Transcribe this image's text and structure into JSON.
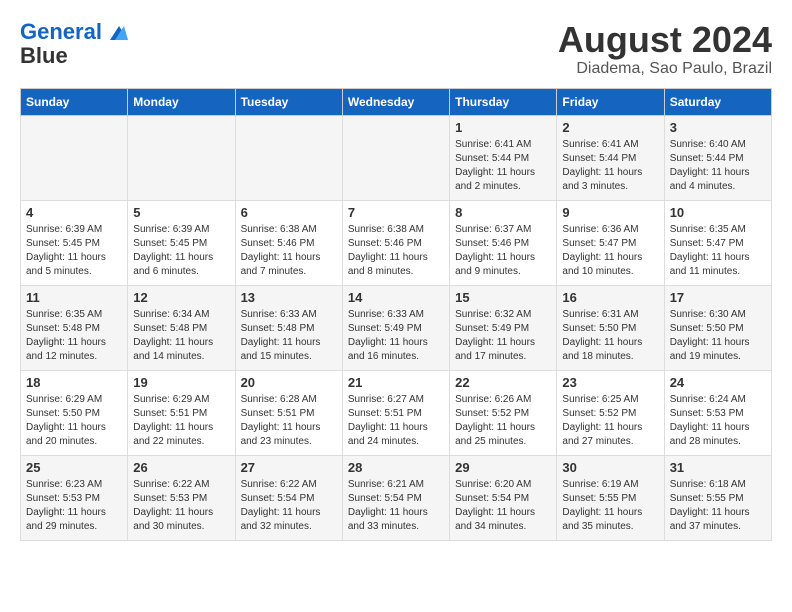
{
  "header": {
    "logo_line1": "General",
    "logo_line2": "Blue",
    "month_title": "August 2024",
    "location": "Diadema, Sao Paulo, Brazil"
  },
  "days_of_week": [
    "Sunday",
    "Monday",
    "Tuesday",
    "Wednesday",
    "Thursday",
    "Friday",
    "Saturday"
  ],
  "weeks": [
    [
      {
        "num": "",
        "info": ""
      },
      {
        "num": "",
        "info": ""
      },
      {
        "num": "",
        "info": ""
      },
      {
        "num": "",
        "info": ""
      },
      {
        "num": "1",
        "info": "Sunrise: 6:41 AM\nSunset: 5:44 PM\nDaylight: 11 hours and 2 minutes."
      },
      {
        "num": "2",
        "info": "Sunrise: 6:41 AM\nSunset: 5:44 PM\nDaylight: 11 hours and 3 minutes."
      },
      {
        "num": "3",
        "info": "Sunrise: 6:40 AM\nSunset: 5:44 PM\nDaylight: 11 hours and 4 minutes."
      }
    ],
    [
      {
        "num": "4",
        "info": "Sunrise: 6:39 AM\nSunset: 5:45 PM\nDaylight: 11 hours and 5 minutes."
      },
      {
        "num": "5",
        "info": "Sunrise: 6:39 AM\nSunset: 5:45 PM\nDaylight: 11 hours and 6 minutes."
      },
      {
        "num": "6",
        "info": "Sunrise: 6:38 AM\nSunset: 5:46 PM\nDaylight: 11 hours and 7 minutes."
      },
      {
        "num": "7",
        "info": "Sunrise: 6:38 AM\nSunset: 5:46 PM\nDaylight: 11 hours and 8 minutes."
      },
      {
        "num": "8",
        "info": "Sunrise: 6:37 AM\nSunset: 5:46 PM\nDaylight: 11 hours and 9 minutes."
      },
      {
        "num": "9",
        "info": "Sunrise: 6:36 AM\nSunset: 5:47 PM\nDaylight: 11 hours and 10 minutes."
      },
      {
        "num": "10",
        "info": "Sunrise: 6:35 AM\nSunset: 5:47 PM\nDaylight: 11 hours and 11 minutes."
      }
    ],
    [
      {
        "num": "11",
        "info": "Sunrise: 6:35 AM\nSunset: 5:48 PM\nDaylight: 11 hours and 12 minutes."
      },
      {
        "num": "12",
        "info": "Sunrise: 6:34 AM\nSunset: 5:48 PM\nDaylight: 11 hours and 14 minutes."
      },
      {
        "num": "13",
        "info": "Sunrise: 6:33 AM\nSunset: 5:48 PM\nDaylight: 11 hours and 15 minutes."
      },
      {
        "num": "14",
        "info": "Sunrise: 6:33 AM\nSunset: 5:49 PM\nDaylight: 11 hours and 16 minutes."
      },
      {
        "num": "15",
        "info": "Sunrise: 6:32 AM\nSunset: 5:49 PM\nDaylight: 11 hours and 17 minutes."
      },
      {
        "num": "16",
        "info": "Sunrise: 6:31 AM\nSunset: 5:50 PM\nDaylight: 11 hours and 18 minutes."
      },
      {
        "num": "17",
        "info": "Sunrise: 6:30 AM\nSunset: 5:50 PM\nDaylight: 11 hours and 19 minutes."
      }
    ],
    [
      {
        "num": "18",
        "info": "Sunrise: 6:29 AM\nSunset: 5:50 PM\nDaylight: 11 hours and 20 minutes."
      },
      {
        "num": "19",
        "info": "Sunrise: 6:29 AM\nSunset: 5:51 PM\nDaylight: 11 hours and 22 minutes."
      },
      {
        "num": "20",
        "info": "Sunrise: 6:28 AM\nSunset: 5:51 PM\nDaylight: 11 hours and 23 minutes."
      },
      {
        "num": "21",
        "info": "Sunrise: 6:27 AM\nSunset: 5:51 PM\nDaylight: 11 hours and 24 minutes."
      },
      {
        "num": "22",
        "info": "Sunrise: 6:26 AM\nSunset: 5:52 PM\nDaylight: 11 hours and 25 minutes."
      },
      {
        "num": "23",
        "info": "Sunrise: 6:25 AM\nSunset: 5:52 PM\nDaylight: 11 hours and 27 minutes."
      },
      {
        "num": "24",
        "info": "Sunrise: 6:24 AM\nSunset: 5:53 PM\nDaylight: 11 hours and 28 minutes."
      }
    ],
    [
      {
        "num": "25",
        "info": "Sunrise: 6:23 AM\nSunset: 5:53 PM\nDaylight: 11 hours and 29 minutes."
      },
      {
        "num": "26",
        "info": "Sunrise: 6:22 AM\nSunset: 5:53 PM\nDaylight: 11 hours and 30 minutes."
      },
      {
        "num": "27",
        "info": "Sunrise: 6:22 AM\nSunset: 5:54 PM\nDaylight: 11 hours and 32 minutes."
      },
      {
        "num": "28",
        "info": "Sunrise: 6:21 AM\nSunset: 5:54 PM\nDaylight: 11 hours and 33 minutes."
      },
      {
        "num": "29",
        "info": "Sunrise: 6:20 AM\nSunset: 5:54 PM\nDaylight: 11 hours and 34 minutes."
      },
      {
        "num": "30",
        "info": "Sunrise: 6:19 AM\nSunset: 5:55 PM\nDaylight: 11 hours and 35 minutes."
      },
      {
        "num": "31",
        "info": "Sunrise: 6:18 AM\nSunset: 5:55 PM\nDaylight: 11 hours and 37 minutes."
      }
    ]
  ]
}
